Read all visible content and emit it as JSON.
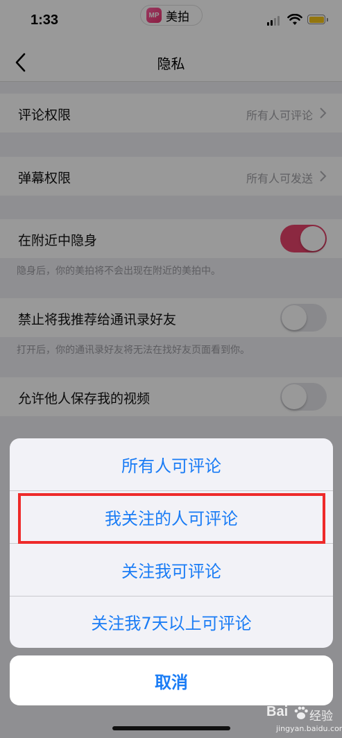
{
  "status_bar": {
    "time": "1:33",
    "app_name": "美拍",
    "app_logo_text": "MP"
  },
  "nav": {
    "title": "隐私"
  },
  "settings": {
    "comment_permission": {
      "label": "评论权限",
      "value": "所有人可评论"
    },
    "danmaku_permission": {
      "label": "弹幕权限",
      "value": "所有人可发送"
    },
    "hide_nearby": {
      "label": "在附近中隐身",
      "on": true,
      "note": "隐身后，你的美拍将不会出现在附近的美拍中。"
    },
    "no_recommend_contacts": {
      "label": "禁止将我推荐给通讯录好友",
      "on": false,
      "note": "打开后，你的通讯录好友将无法在找好友页面看到你。"
    },
    "allow_save_videos": {
      "label": "允许他人保存我的视频",
      "on": false
    }
  },
  "action_sheet": {
    "options": [
      "所有人可评论",
      "我关注的人可评论",
      "关注我可评论",
      "关注我7天以上可评论"
    ],
    "cancel_label": "取消"
  },
  "colors": {
    "accent": "#1a7cf5",
    "toggle_on": "#e8436b",
    "highlight": "#ee2a2a"
  },
  "watermark": {
    "brand": "Bai",
    "text": "经验",
    "url": "jingyan.baidu.com"
  }
}
